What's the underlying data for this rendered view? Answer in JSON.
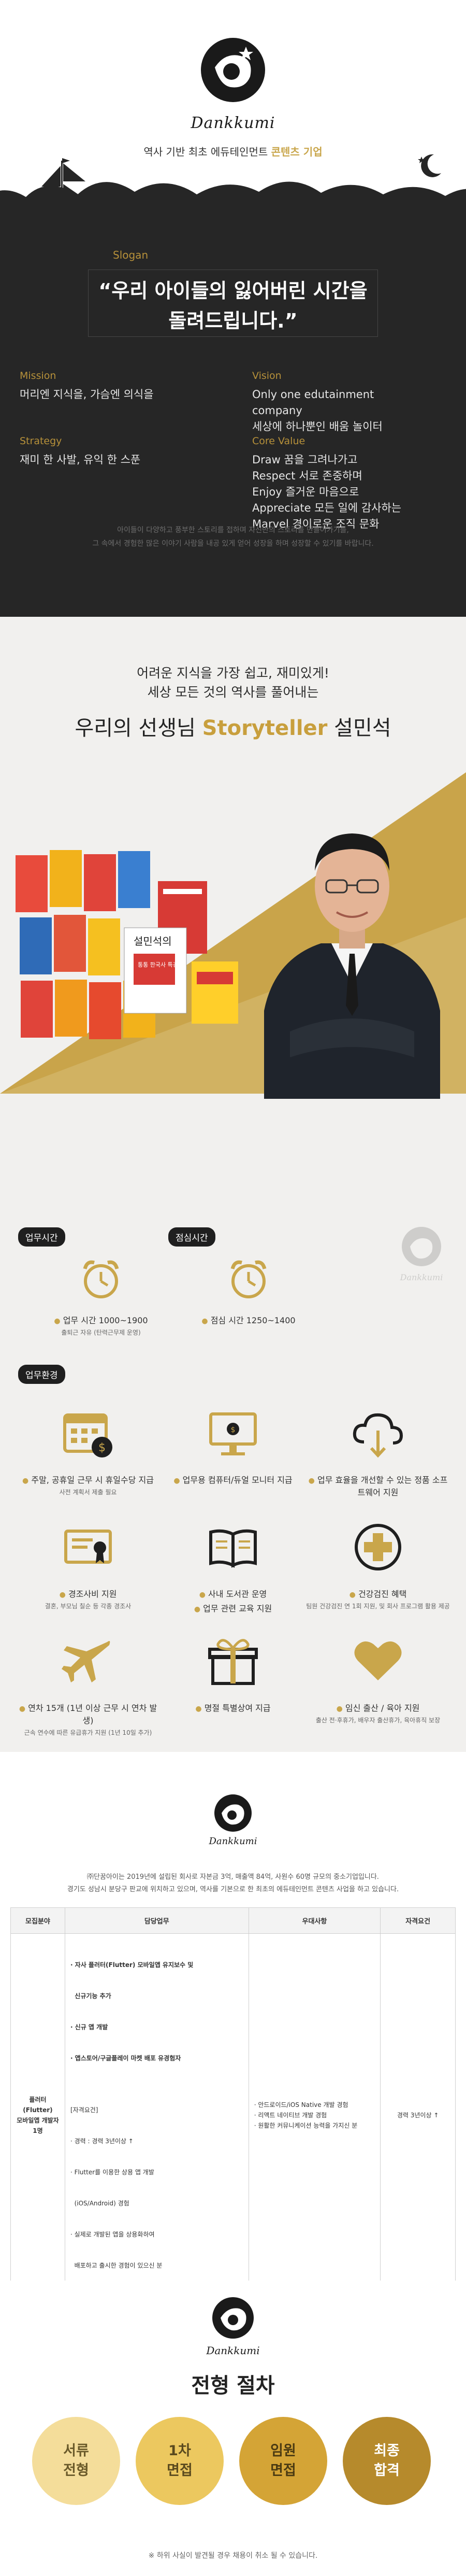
{
  "brand": {
    "logo_name": "Dankkumi",
    "tagline_prefix": "역사 기반 최초 에듀테인먼트",
    "tagline_accent": "콘텐츠 기업",
    "accent_color": "#c9a64b"
  },
  "hero": {
    "slogan_label": "Slogan",
    "slogan_line1": "“우리 아이들의 잃어버린 시간을",
    "slogan_line2": "돌려드립니다.”",
    "mission_label": "Mission",
    "mission_text": "머리엔 지식을, 가슴엔 의식을",
    "vision_label": "Vision",
    "vision_line1": "Only one edutainment company",
    "vision_line2": "세상에 하나뿐인 배움 놀이터",
    "strategy_label": "Strategy",
    "strategy_text": "재미 한 사발, 유익 한 스푼",
    "core_label": "Core Value",
    "core_values": [
      "Draw 꿈을 그려나가고",
      "Respect 서로 존중하며",
      "Enjoy 즐거운 마음으로",
      "Appreciate 모든 일에 감사하는",
      "Marvel 경이로운 조직 문화"
    ],
    "foot_line1": "아이들이 다양하고 풍부한 스토리를 접하며 자신만의 스토리를 만들어가기를,",
    "foot_line2": "그 속에서 경험한 많은 이야기 사람을 내공 있게 얻어 성장을 하며 성장할 수 있기를 바랍니다."
  },
  "story": {
    "intro_line1": "어려운 지식을 가장 쉽고, 재미있게!",
    "intro_line2": "세상 모든 것의 역사를 풀어내는",
    "title_prefix": "우리의 선생님",
    "title_highlight": "Storyteller",
    "title_suffix": "설민석",
    "book_title": "설민석의",
    "book_sub": "통통 한국사 특강"
  },
  "benefits": {
    "hours_label": "업무시간",
    "hours_text": "업무 시간 1000~1900",
    "hours_sub": "출퇴근 자유 (탄력근무제 운영)",
    "lunch_label": "점심시간",
    "lunch_text": "점심 시간 1250~1400",
    "env_label": "업무환경",
    "items": [
      {
        "title": "주말, 공휴일 근무 시 휴일수당 지급",
        "sub": "사전 계획서 제출 필요"
      },
      {
        "title": "업무용 컴퓨터/듀얼 모니터 지급",
        "sub": ""
      },
      {
        "title": "업무 효율을 개선할 수 있는 정품 소프트웨어 지원",
        "sub": ""
      },
      {
        "title": "경조사비 지원",
        "sub": "결혼, 부모님 칠순 등 각종 경조사"
      },
      {
        "title": "사내 도서관 운영",
        "sub": "업무 관련 교육 지원"
      },
      {
        "title": "건강검진 혜택",
        "sub": "팀원 건강검진 연 1회 지원, 및 회사 프로그램 활용 제공"
      },
      {
        "title": "연차 15개 (1년 이상 근무 시 연차 발생)",
        "sub": "근속 연수에 따른 유급휴가 지원 (1년 10일 추가)"
      },
      {
        "title": "명절 특별상여 지급",
        "sub": ""
      },
      {
        "title": "임신 출산 / 육아 지원",
        "sub": "출산 전·후휴가, 배우자 출산휴가, 육아휴직 보장"
      }
    ]
  },
  "recruit": {
    "intro_line1": "㈜단꿈아이는 2019년에 설립된 회사로 자본금 3억, 매출액 84억, 사원수 60명 규모의 중소기업입니다.",
    "intro_line2": "경기도 성남시 분당구 판교에 위치하고 있으며, 역사를 기본으로 한 최초의 에듀테인먼트 콘텐츠 사업을 하고 있습니다.",
    "columns": [
      "모집분야",
      "담당업무",
      "우대사항",
      "자격요건"
    ],
    "row": {
      "field_line1": "플러터(Flutter)",
      "field_line2": "모바일앱 개발자",
      "field_line3": "1명",
      "duties": [
        "· 자사 플러터(Flutter) 모바일앱 유지보수 및",
        "  신규기능 추가",
        "· 신규 앱 개발",
        "· 앱스토어/구글플레이 마켓 배포 유경험자",
        "",
        "[자격요건]",
        "· 경력 : 경력 3년이상 ↑",
        "· Flutter를 이용한 상용 앱 개발",
        "  (iOS/Android) 경험",
        "· 실제로 개발된 앱을 상용화하여",
        "  배포하고 출시한 경험이 있으신 분"
      ],
      "prefs": [
        "· 안드로이드/iOS Native 개발 경험",
        "· 리액트 네이티브 개발 경험",
        "· 원활한 커뮤니케이션 능력을 가지신 분"
      ],
      "requirement": "경력 3년이상 ↑"
    }
  },
  "process": {
    "title": "전형 절차",
    "steps": [
      {
        "line1": "서류",
        "line2": "전형"
      },
      {
        "line1": "1차",
        "line2": "면접"
      },
      {
        "line1": "임원",
        "line2": "면접"
      },
      {
        "line1": "최종",
        "line2": "합격"
      }
    ],
    "note": "※ 하위 사실이 발견될 경우 채용이 취소 될 수 있습니다."
  }
}
